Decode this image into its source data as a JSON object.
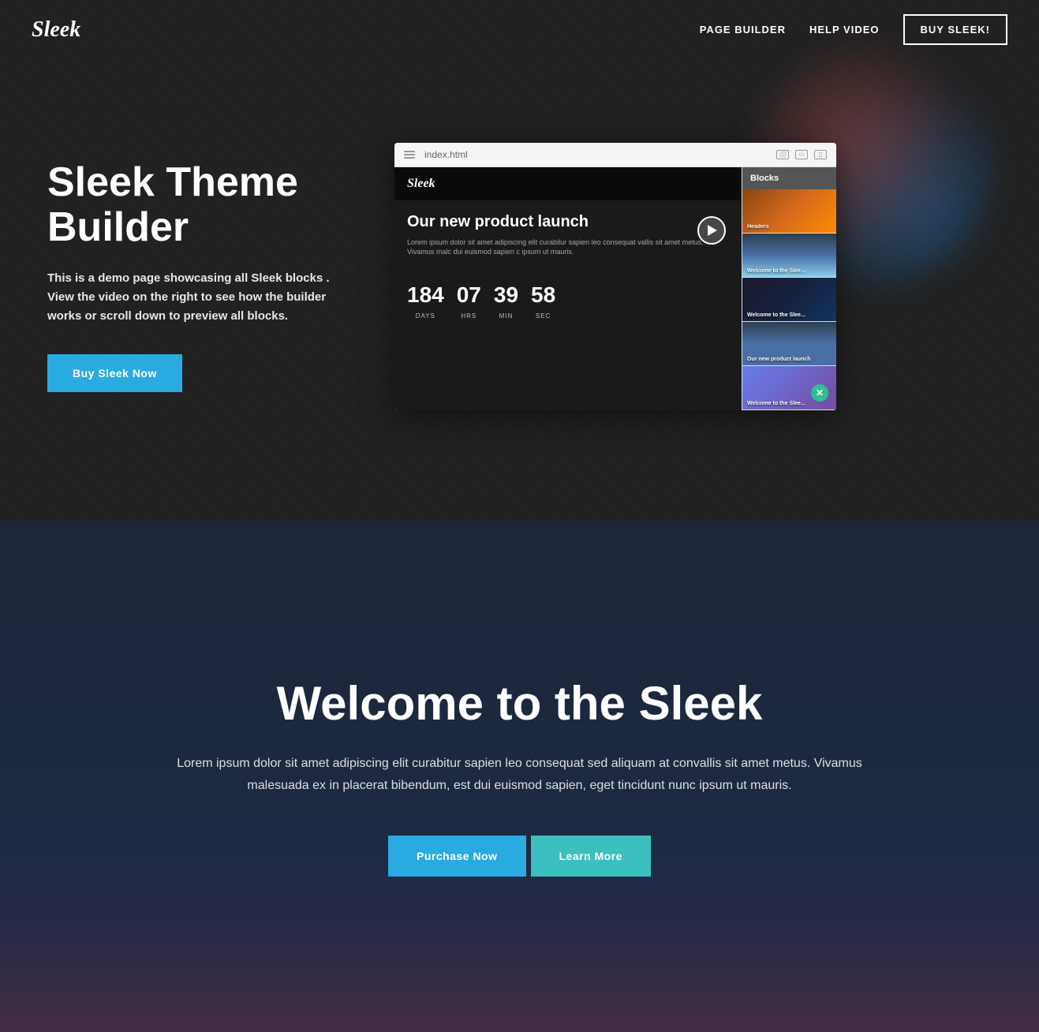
{
  "nav": {
    "logo": "Sleek",
    "links": [
      {
        "label": "PAGE BUILDER",
        "href": "#"
      },
      {
        "label": "HELP VIDEO",
        "href": "#"
      },
      {
        "label": "BUY SLEEK!",
        "href": "#",
        "isBtn": true
      }
    ]
  },
  "hero": {
    "title": "Sleek Theme Builder",
    "description": "This is a demo page showcasing all Sleek blocks . View the video on the right to see how the builder works or scroll down to preview all blocks.",
    "cta_label": "Buy Sleek Now",
    "mockup": {
      "url": "index.html",
      "main_logo": "Sleek",
      "main_title": "Our new product launch",
      "main_text": "Lorem ipsum dolor sit amet adipiscing elit curabilur sapien leo consequat vallis sit amet metus. Vivamus malc dui euismod sapien c ipsum ut mauris.",
      "countdown": [
        {
          "num": "184",
          "label": "DAYS"
        },
        {
          "num": "07",
          "label": "HRS"
        },
        {
          "num": "39",
          "label": "MIN"
        },
        {
          "num": "58",
          "label": "SEC"
        }
      ],
      "sidebar_header": "Blocks",
      "blocks": [
        {
          "label": "Headers"
        },
        {
          "label": "Welcome to the Slee..."
        },
        {
          "label": "Welcome to the Slee..."
        },
        {
          "label": "Our new product launch"
        },
        {
          "label": "Welcome to the Slee..."
        }
      ]
    }
  },
  "welcome": {
    "title": "Welcome to the Sleek",
    "description": "Lorem ipsum dolor sit amet adipiscing elit curabitur sapien leo consequat sed aliquam at convallis sit amet metus. Vivamus malesuada ex in placerat bibendum, est dui euismod sapien, eget tincidunt nunc ipsum ut mauris.",
    "purchase_label": "Purchase Now",
    "learn_label": "Learn More"
  }
}
